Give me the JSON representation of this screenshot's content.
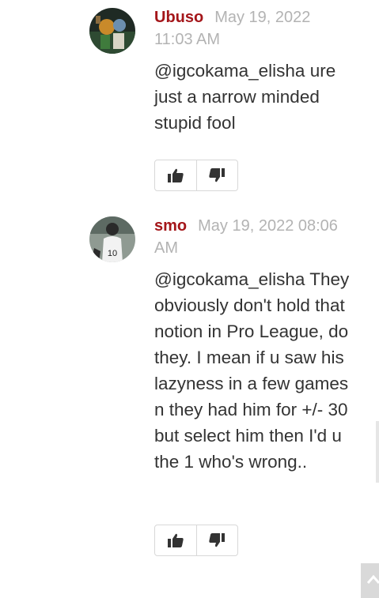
{
  "comments": [
    {
      "author": "Ubuso",
      "timestamp": "May 19, 2022 11:03 AM",
      "text": "@igcokama_elisha ure just a narrow minded stupid fool",
      "avatar_icon": "user-avatar-image",
      "actions": {
        "like_icon": "thumbs-up-icon",
        "dislike_icon": "thumbs-down-icon"
      }
    },
    {
      "author": "smo",
      "timestamp": "May 19, 2022 08:06 AM",
      "text": "@igcokama_elisha They obviously don't hold that notion in Pro League, do they. I mean if u saw his lazyness in a few games n they had him for +/- 30 but select him then I'd u the 1 who's wrong..",
      "avatar_icon": "user-avatar-image",
      "actions": {
        "like_icon": "thumbs-up-icon",
        "dislike_icon": "thumbs-down-icon"
      }
    }
  ],
  "scroll_top_icon": "chevron-up-icon",
  "colors": {
    "author": "#a4161a",
    "meta": "#b3b3b3",
    "text": "#333333",
    "icon": "#333333"
  }
}
